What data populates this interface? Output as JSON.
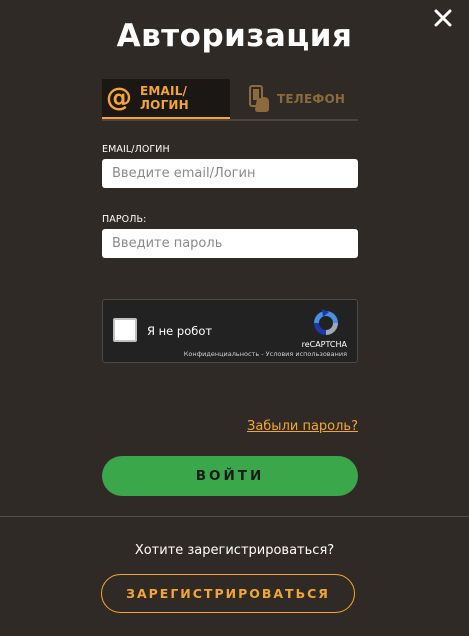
{
  "modal": {
    "title": "Авторизация"
  },
  "tabs": [
    {
      "label": "EMAIL/ЛОГИН",
      "icon": "at-icon",
      "active": true
    },
    {
      "label": "ТЕЛЕФОН",
      "icon": "phone-hand-icon",
      "active": false
    }
  ],
  "form": {
    "email_label": "EMAIL/ЛОГИН",
    "email_placeholder": "Введите email/Логин",
    "email_value": "",
    "password_label": "ПАРОЛЬ:",
    "password_placeholder": "Введите пароль",
    "password_value": ""
  },
  "recaptcha": {
    "label": "Я не робот",
    "brand": "reCAPTCHA",
    "privacy": "Конфиденциальность",
    "separator": " - ",
    "terms": "Условия использования",
    "checked": false
  },
  "actions": {
    "forgot_label": "Забыли пароль?",
    "login_label": "ВОЙТИ",
    "register_prompt": "Хотите зарегистрироваться?",
    "register_label": "ЗАРЕГИСТРИРОВАТЬСЯ"
  },
  "colors": {
    "background": "#2f2a26",
    "accent": "#f4a634",
    "login_button": "#3aa84a"
  }
}
